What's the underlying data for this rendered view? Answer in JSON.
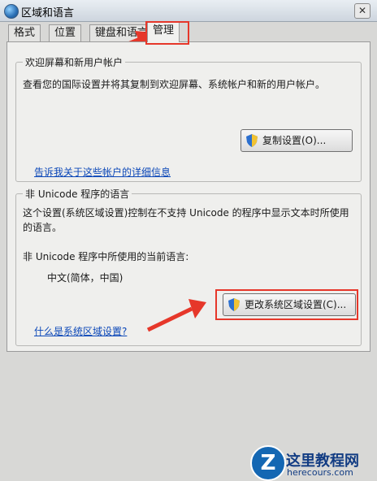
{
  "window": {
    "title": "区域和语言",
    "close_glyph": "✕"
  },
  "tabs": [
    {
      "label": "格式"
    },
    {
      "label": "位置"
    },
    {
      "label": "键盘和语言"
    },
    {
      "label": "管理",
      "active": true
    }
  ],
  "welcome": {
    "group_title": "欢迎屏幕和新用户帐户",
    "description": "查看您的国际设置并将其复制到欢迎屏幕、系统帐户和新的用户帐户。",
    "copy_button": "复制设置(O)...",
    "link": "告诉我关于这些帐户的详细信息"
  },
  "non_unicode": {
    "group_title": "非 Unicode 程序的语言",
    "description_line1": "这个设置(系统区域设置)控制在不支持 Unicode 的程序中显示文本时所使用",
    "description_line2": "的语言。",
    "current_label": "非 Unicode 程序中所使用的当前语言:",
    "current_value": "中文(简体，中国)",
    "change_button": "更改系统区域设置(C)...",
    "link": "什么是系统区域设置?"
  },
  "watermark": {
    "title": "这里教程网",
    "url": "herecours.com",
    "logo_letter": "Z"
  },
  "colors": {
    "highlight": "#e6372a",
    "link": "#0b47b8"
  }
}
